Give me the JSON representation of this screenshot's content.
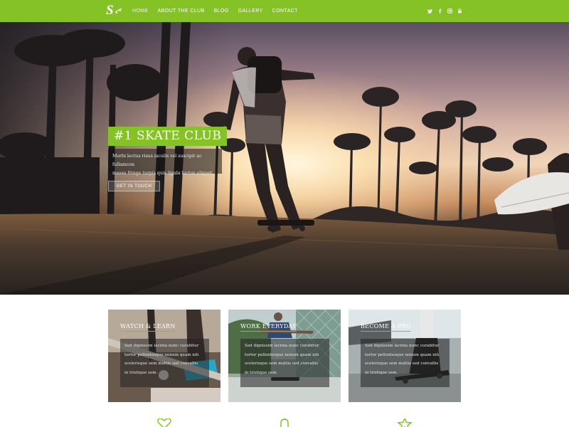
{
  "colors": {
    "accent": "#84c225",
    "white": "#ffffff"
  },
  "nav": {
    "logo_icon": "skate-club-logo",
    "links": [
      {
        "label": "HOME",
        "active": true
      },
      {
        "label": "ABOUT THE CLUB",
        "active": false
      },
      {
        "label": "BLOG",
        "active": false
      },
      {
        "label": "GALLERY",
        "active": false
      },
      {
        "label": "CONTACT",
        "active": false
      }
    ],
    "social_icons": [
      "twitter-icon",
      "facebook-icon",
      "instagram-icon",
      "youtube-icon"
    ]
  },
  "hero": {
    "title": "#1 SKATE CLUB",
    "text_line1": "Morbi lectus risus iaculis vel suscipit ac fullamcon",
    "text_line2": "massa fringe turpis quis ligula luctus aliquet.",
    "button_label": "GET IN TOUCH"
  },
  "cards": [
    {
      "title": "WATCH & LEARN",
      "lines": [
        "Sed dignissim lacinia nunc curabitur",
        "tortor pellentesque nonum quam nih",
        "scelerisque sem mattis sed convallis",
        "in tristique sem."
      ]
    },
    {
      "title": "WORK EVERYDAY",
      "lines": [
        "Sed dignissim lacinia nunc curabitur",
        "tortor pellentesque nonum quam nih",
        "scelerisque sem mattis sed convallis",
        "in tristique sem."
      ]
    },
    {
      "title": "BECOME A PRO",
      "lines": [
        "Sed dignissim lacinia nunc curabitur",
        "tortor pellentesque nonum quam nih",
        "scelerisque sem mattis sed convallis",
        "in tristique sem."
      ]
    }
  ],
  "feature_icons": [
    "heart-icon",
    "bell-icon",
    "star-icon"
  ]
}
